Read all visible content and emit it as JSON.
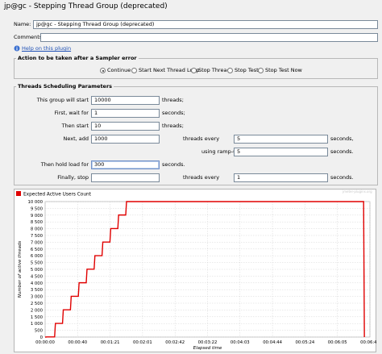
{
  "window": {
    "title": "jp@gc - Stepping Thread Group (deprecated)"
  },
  "form": {
    "name_label": "Name:",
    "name_value": "jp@gc - Stepping Thread Group (deprecated)",
    "comments_label": "Comments:",
    "comments_value": "",
    "help_link": "Help on this plugin"
  },
  "sampler_error": {
    "title": "Action to be taken after a Sampler error",
    "options": [
      "Continue",
      "Start Next Thread Loop",
      "Stop Thread",
      "Stop Test",
      "Stop Test Now"
    ],
    "selected": "Continue"
  },
  "scheduling": {
    "title": "Threads Scheduling Parameters",
    "start_label": "This group will start",
    "start_value": "10000",
    "start_unit": "threads;",
    "wait_label": "First, wait for",
    "wait_value": "1",
    "wait_unit": "seconds;",
    "then_start_label": "Then start",
    "then_start_value": "10",
    "then_start_unit": "threads;",
    "next_add_label": "Next, add",
    "next_add_value": "1000",
    "threads_every_label": "threads every",
    "threads_every_value": "5",
    "threads_every_unit": "seconds,",
    "ramp_up_label": "using ramp-up",
    "ramp_up_value": "5",
    "ramp_up_unit": "seconds.",
    "hold_label": "Then hold load for",
    "hold_value": "300",
    "hold_unit": "seconds.",
    "stop_label": "Finally, stop",
    "stop_value": "",
    "stop_threads_every_label": "threads every",
    "stop_every_value": "1",
    "stop_every_unit": "seconds."
  },
  "chart_watermark": "jmeter-plugins.org",
  "chart_data": {
    "type": "line",
    "legend": [
      "Expected Active Users Count"
    ],
    "legend_position": "top-left",
    "xlabel": "Elapsed time",
    "ylabel": "Number of active threads",
    "ylim": [
      0,
      10000
    ],
    "y_ticks": [
      "0",
      "500",
      "1 000",
      "1 500",
      "2 000",
      "2 500",
      "3 000",
      "3 500",
      "4 000",
      "4 500",
      "5 000",
      "5 500",
      "6 000",
      "6 500",
      "7 000",
      "7 500",
      "8 000",
      "8 500",
      "9 000",
      "9 500",
      "10 000"
    ],
    "x_ticks": [
      "00:00:00",
      "00:00:40",
      "00:01:21",
      "00:02:01",
      "00:02:42",
      "00:03:22",
      "00:04:03",
      "00:04:44",
      "00:05:24",
      "00:06:05",
      "00:06:45"
    ],
    "xlim_seconds": [
      0,
      411
    ],
    "grid": true,
    "series": [
      {
        "name": "Expected Active Users Count",
        "color": "#e00000",
        "x_seconds": [
          0,
          1,
          2,
          12,
          13,
          17,
          18,
          22,
          23,
          27,
          28,
          32,
          33,
          37,
          38,
          42,
          43,
          47,
          48,
          52,
          53,
          57,
          58,
          62,
          63,
          67,
          68,
          72,
          73,
          77,
          78,
          82,
          83,
          87,
          88,
          92,
          93,
          97,
          98,
          102,
          103,
          403,
          404
        ],
        "y": [
          0,
          0,
          10,
          10,
          1010,
          1010,
          1010,
          1010,
          2010,
          2010,
          2010,
          2010,
          3010,
          3010,
          3010,
          3010,
          4010,
          4010,
          4010,
          4010,
          5010,
          5010,
          5010,
          5010,
          6010,
          6010,
          6010,
          6010,
          7010,
          7010,
          7010,
          7010,
          8010,
          8010,
          8010,
          8010,
          9010,
          9010,
          9010,
          9010,
          10000,
          10000,
          0
        ]
      }
    ]
  }
}
